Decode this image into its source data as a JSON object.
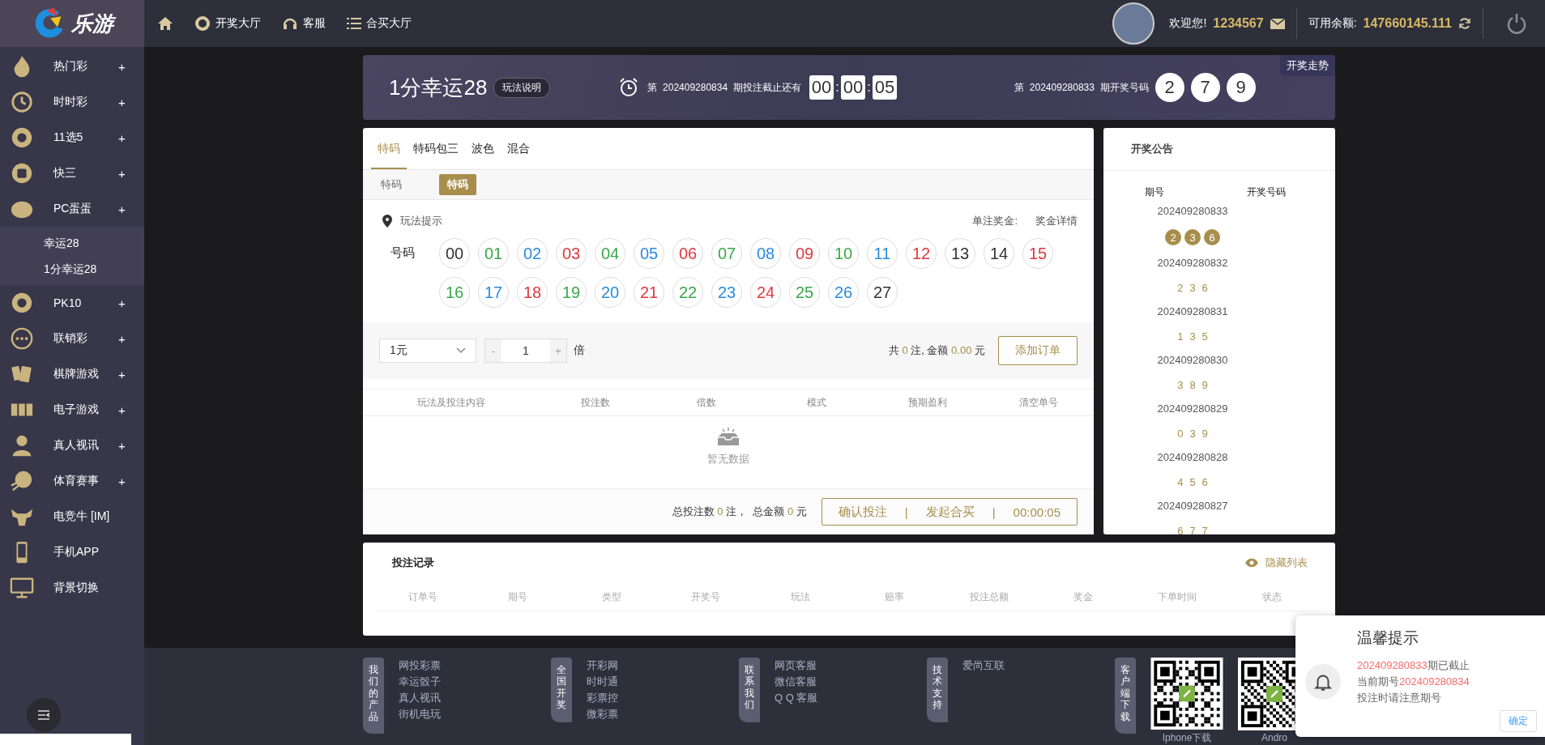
{
  "brand": {
    "name": "乐游"
  },
  "top_nav": [
    {
      "label": "开奖大厅"
    },
    {
      "label": "客服"
    },
    {
      "label": "合买大厅"
    }
  ],
  "user": {
    "greeting": "欢迎您!",
    "username": "1234567",
    "balance_label": "可用余额:",
    "balance": "147660145.111"
  },
  "sidebar": {
    "items": [
      {
        "label": "热门彩",
        "expander": "+"
      },
      {
        "label": "时时彩",
        "expander": "+"
      },
      {
        "label": "11选5",
        "expander": "+"
      },
      {
        "label": "快三",
        "expander": "+"
      },
      {
        "label": "PC蛋蛋",
        "expander": "+",
        "children": [
          {
            "label": "幸运28"
          },
          {
            "label": "1分幸运28"
          }
        ]
      },
      {
        "label": "PK10",
        "expander": "+"
      },
      {
        "label": "联销彩",
        "expander": "+"
      },
      {
        "label": "棋牌游戏",
        "expander": "+"
      },
      {
        "label": "电子游戏",
        "expander": "+"
      },
      {
        "label": "真人视讯",
        "expander": "+"
      },
      {
        "label": "体育赛事",
        "expander": "+"
      },
      {
        "label": "电竞牛  [IM]"
      },
      {
        "label": "手机APP"
      },
      {
        "label": "背景切换"
      }
    ]
  },
  "header": {
    "title": "1分幸运28",
    "rules_button": "玩法说明",
    "deadline_text": "第  202409280834  期投注截止还有",
    "timer": [
      "00",
      "00",
      "05"
    ],
    "timer_separator": ":",
    "last_draw_text": "第  202409280833  期开奖号码",
    "last_draw": [
      "2",
      "7",
      "9"
    ],
    "trend_tab": "开奖走势"
  },
  "bet": {
    "tabs": [
      {
        "label": "特码",
        "selected": true
      },
      {
        "label": "特码包三",
        "selected": false
      },
      {
        "label": "波色",
        "selected": false
      },
      {
        "label": "混合",
        "selected": false
      }
    ],
    "sub_label": "特码",
    "sub_options": [
      {
        "label": "特码",
        "selected": true
      }
    ],
    "hint": "玩法提示",
    "prize_label": "单注奖金:",
    "prize_link": "奖金详情",
    "number_label": "号码",
    "balls": [
      {
        "n": "00",
        "color": "#333333"
      },
      {
        "n": "01",
        "color": "#3aa64a"
      },
      {
        "n": "02",
        "color": "#2a8be0"
      },
      {
        "n": "03",
        "color": "#e0383d"
      },
      {
        "n": "04",
        "color": "#3aa64a"
      },
      {
        "n": "05",
        "color": "#2a8be0"
      },
      {
        "n": "06",
        "color": "#e0383d"
      },
      {
        "n": "07",
        "color": "#3aa64a"
      },
      {
        "n": "08",
        "color": "#2a8be0"
      },
      {
        "n": "09",
        "color": "#e0383d"
      },
      {
        "n": "10",
        "color": "#3aa64a"
      },
      {
        "n": "11",
        "color": "#2a8be0"
      },
      {
        "n": "12",
        "color": "#e0383d"
      },
      {
        "n": "13",
        "color": "#333333"
      },
      {
        "n": "14",
        "color": "#333333"
      },
      {
        "n": "15",
        "color": "#e0383d"
      },
      {
        "n": "16",
        "color": "#3aa64a"
      },
      {
        "n": "17",
        "color": "#2a8be0"
      },
      {
        "n": "18",
        "color": "#e0383d"
      },
      {
        "n": "19",
        "color": "#3aa64a"
      },
      {
        "n": "20",
        "color": "#2a8be0"
      },
      {
        "n": "21",
        "color": "#e0383d"
      },
      {
        "n": "22",
        "color": "#3aa64a"
      },
      {
        "n": "23",
        "color": "#2a8be0"
      },
      {
        "n": "24",
        "color": "#e0383d"
      },
      {
        "n": "25",
        "color": "#3aa64a"
      },
      {
        "n": "26",
        "color": "#2a8be0"
      },
      {
        "n": "27",
        "color": "#333333"
      }
    ],
    "unit": "1元",
    "minus": "-",
    "multiplier": "1",
    "plus": "+",
    "multiplier_unit": "倍",
    "summary": {
      "prefix": "共",
      "count": "0",
      "mid": "注, 金额",
      "amount": "0.00",
      "suffix": "元"
    },
    "add_button": "添加订单",
    "cart_columns": [
      "玩法及投注内容",
      "投注数",
      "倍数",
      "模式",
      "预期盈利",
      "清空单号"
    ],
    "empty": "暂无数据",
    "totals": {
      "count_label": "总投注数",
      "count": "0",
      "count_unit": "注，",
      "amount_label": "总金额",
      "amount": "0",
      "amount_unit": "元"
    },
    "confirm_button": "确认投注",
    "group_button": "发起合买",
    "countdown": "00:00:05",
    "separator": "|"
  },
  "draws": {
    "title": "开奖公告",
    "columns": [
      "期号",
      "开奖号码"
    ],
    "rows": [
      {
        "issue": "202409280833",
        "numbers": [
          "2",
          "3",
          "6"
        ],
        "kind": "latest"
      },
      {
        "issue": "202409280832",
        "numbers": [
          "2",
          "3",
          "6"
        ],
        "kind": "plain"
      },
      {
        "issue": "202409280831",
        "numbers": [
          "1",
          "3",
          "5"
        ],
        "kind": "plain"
      },
      {
        "issue": "202409280830",
        "numbers": [
          "3",
          "8",
          "9"
        ],
        "kind": "plain"
      },
      {
        "issue": "202409280829",
        "numbers": [
          "0",
          "3",
          "9"
        ],
        "kind": "plain"
      },
      {
        "issue": "202409280828",
        "numbers": [
          "4",
          "5",
          "6"
        ],
        "kind": "plain"
      },
      {
        "issue": "202409280827",
        "numbers": [
          "6",
          "7",
          "7"
        ],
        "kind": "plain"
      }
    ]
  },
  "records": {
    "title": "投注记录",
    "toggle": "隐藏列表",
    "columns": [
      "订单号",
      "期号",
      "类型",
      "开奖号",
      "玩法",
      "赔率",
      "投注总额",
      "奖金",
      "下单时间",
      "状态"
    ]
  },
  "footer": {
    "groups": [
      {
        "label": "我们的产品",
        "links": [
          "网投彩票",
          "幸运骰子",
          "真人视讯",
          "街机电玩"
        ]
      },
      {
        "label": "全国开奖",
        "links": [
          "开彩网",
          "时时通",
          "彩票控",
          "微彩票"
        ]
      },
      {
        "label": "联系我们",
        "links": [
          "网页客服",
          "微信客服",
          "Q Q 客服"
        ]
      },
      {
        "label": "技术支持",
        "links": [
          "爱尚互联"
        ]
      }
    ],
    "download": {
      "label": "客户端下载",
      "apps": [
        "Iphone下载",
        "Andro"
      ]
    }
  },
  "toast": {
    "title": "温馨提示",
    "lines": [
      [
        {
          "text": "202409280833",
          "kind": "highlight"
        },
        {
          "text": "期已截止",
          "kind": "plain"
        }
      ],
      [
        {
          "text": "当前期号",
          "kind": "plain"
        },
        {
          "text": "202409280834",
          "kind": "highlight"
        }
      ],
      [
        {
          "text": "投注时请注意期号",
          "kind": "plain"
        }
      ]
    ],
    "button": "确定"
  }
}
